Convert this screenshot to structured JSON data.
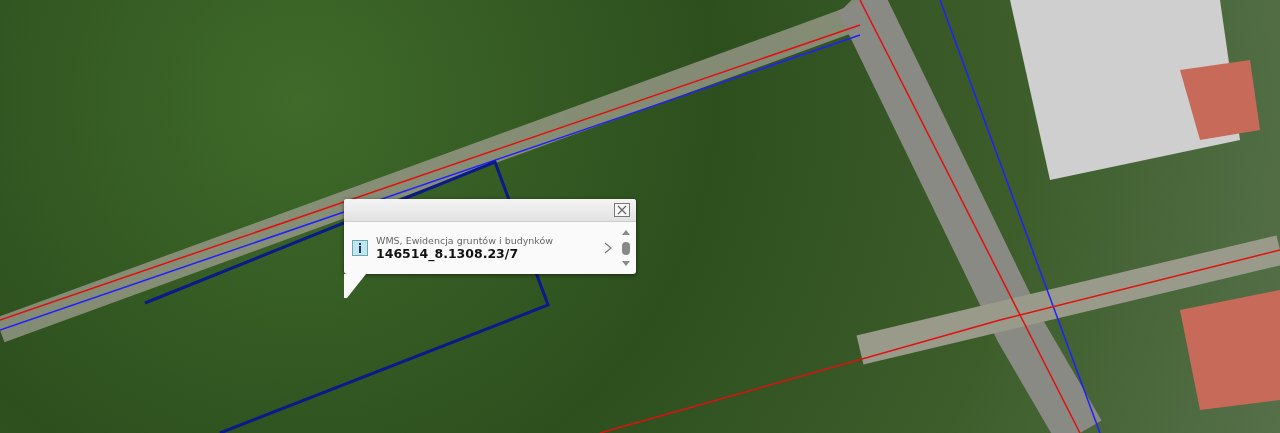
{
  "popup": {
    "source": "WMS, Ewidencja gruntów i budynków",
    "parcel_id": "146514_8.1308.23/7"
  }
}
